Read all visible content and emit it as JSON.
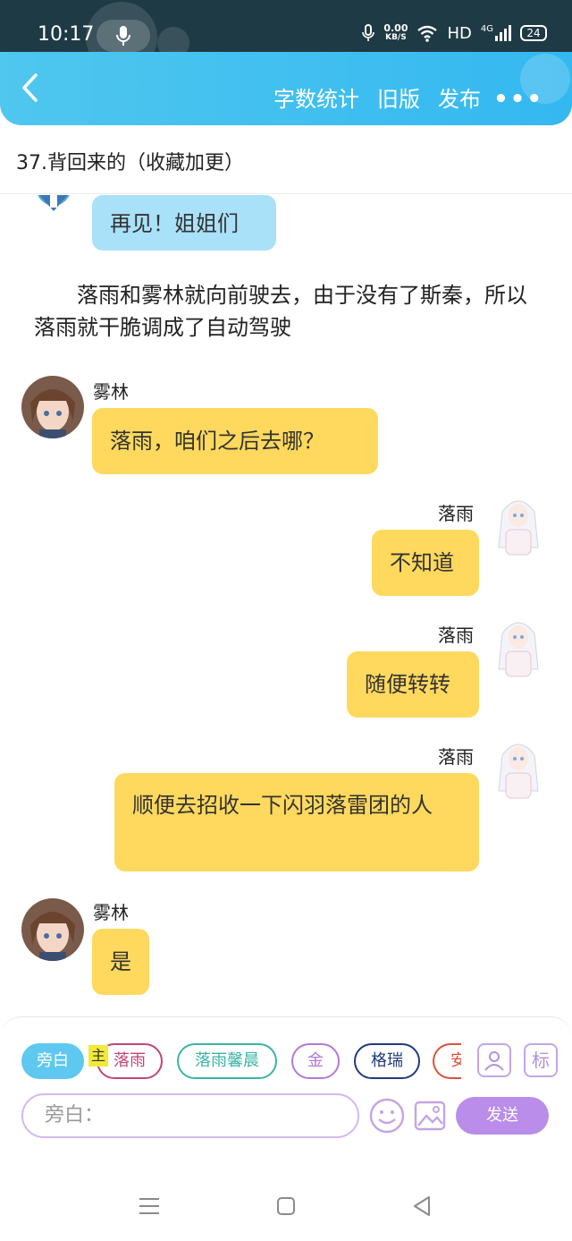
{
  "status_bar": {
    "time": "10:17",
    "net_speed_value": "0.00",
    "net_speed_unit": "KB/S",
    "network_label": "HD",
    "signal_label": "4G",
    "battery": "24"
  },
  "header": {
    "actions": [
      "字数统计",
      "旧版",
      "发布"
    ],
    "more": "•••"
  },
  "chapter_title": "37.背回来的（收藏加更）",
  "chat": {
    "m0_text": "再见！姐姐们",
    "narration": "落雨和雾林就向前驶去，由于没有了斯秦，所以落雨就干脆调成了自动驾驶",
    "m1_name": "雾林",
    "m1_text": "落雨，咱们之后去哪？",
    "m2_name": "落雨",
    "m2_text": "不知道",
    "m3_name": "落雨",
    "m3_text": "随便转转",
    "m4_name": "落雨",
    "m4_text": "顺便去招收一下闪羽落雷团的人",
    "m5_name": "雾林",
    "m5_text": "是"
  },
  "roles": {
    "chips": [
      "旁白",
      "落雨",
      "落雨馨晨",
      "金",
      "格瑞",
      "安"
    ],
    "main_tag": "主",
    "tag_tool": "标"
  },
  "input": {
    "placeholder": "旁白：",
    "send": "发送"
  },
  "colors": {
    "header": "#34b8f0",
    "bubble_left": "#a9e1f9",
    "bubble_yellow": "#ffd95d",
    "send": "#b98de9",
    "chip_active": "#5fc8f0"
  }
}
